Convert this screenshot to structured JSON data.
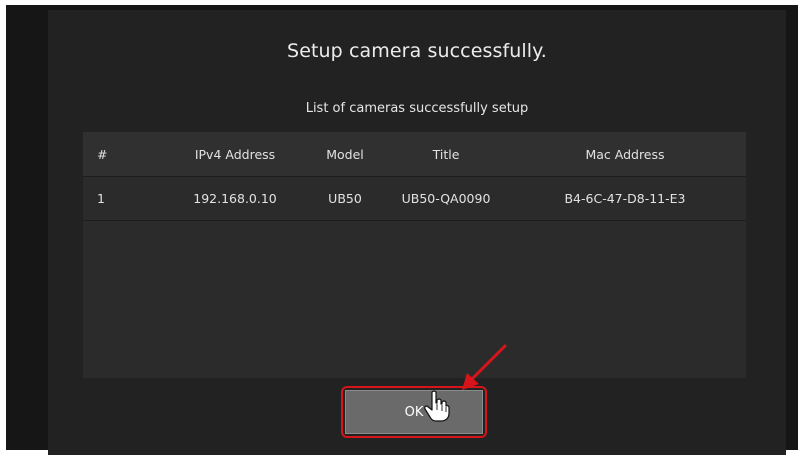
{
  "dialog": {
    "title": "Setup camera successfully.",
    "subtitle": "List of cameras successfully setup"
  },
  "table": {
    "headers": [
      "#",
      "IPv4 Address",
      "Model",
      "Title",
      "Mac Address"
    ],
    "rows": [
      [
        "1",
        "192.168.0.10",
        "UB50",
        "UB50-QA0090",
        "B4-6C-47-D8-11-E3"
      ]
    ]
  },
  "actions": {
    "ok_label": "OK"
  },
  "annotations": {
    "highlight_color": "#d7141a",
    "arrow_icon": "red-arrow-pointing-to-ok",
    "cursor_icon": "hand-pointer-cursor"
  },
  "colors": {
    "dialog_background": "#222222",
    "table_background": "#2b2b2b",
    "button_background": "#6a6a6a",
    "text": "#e2e2e2"
  }
}
